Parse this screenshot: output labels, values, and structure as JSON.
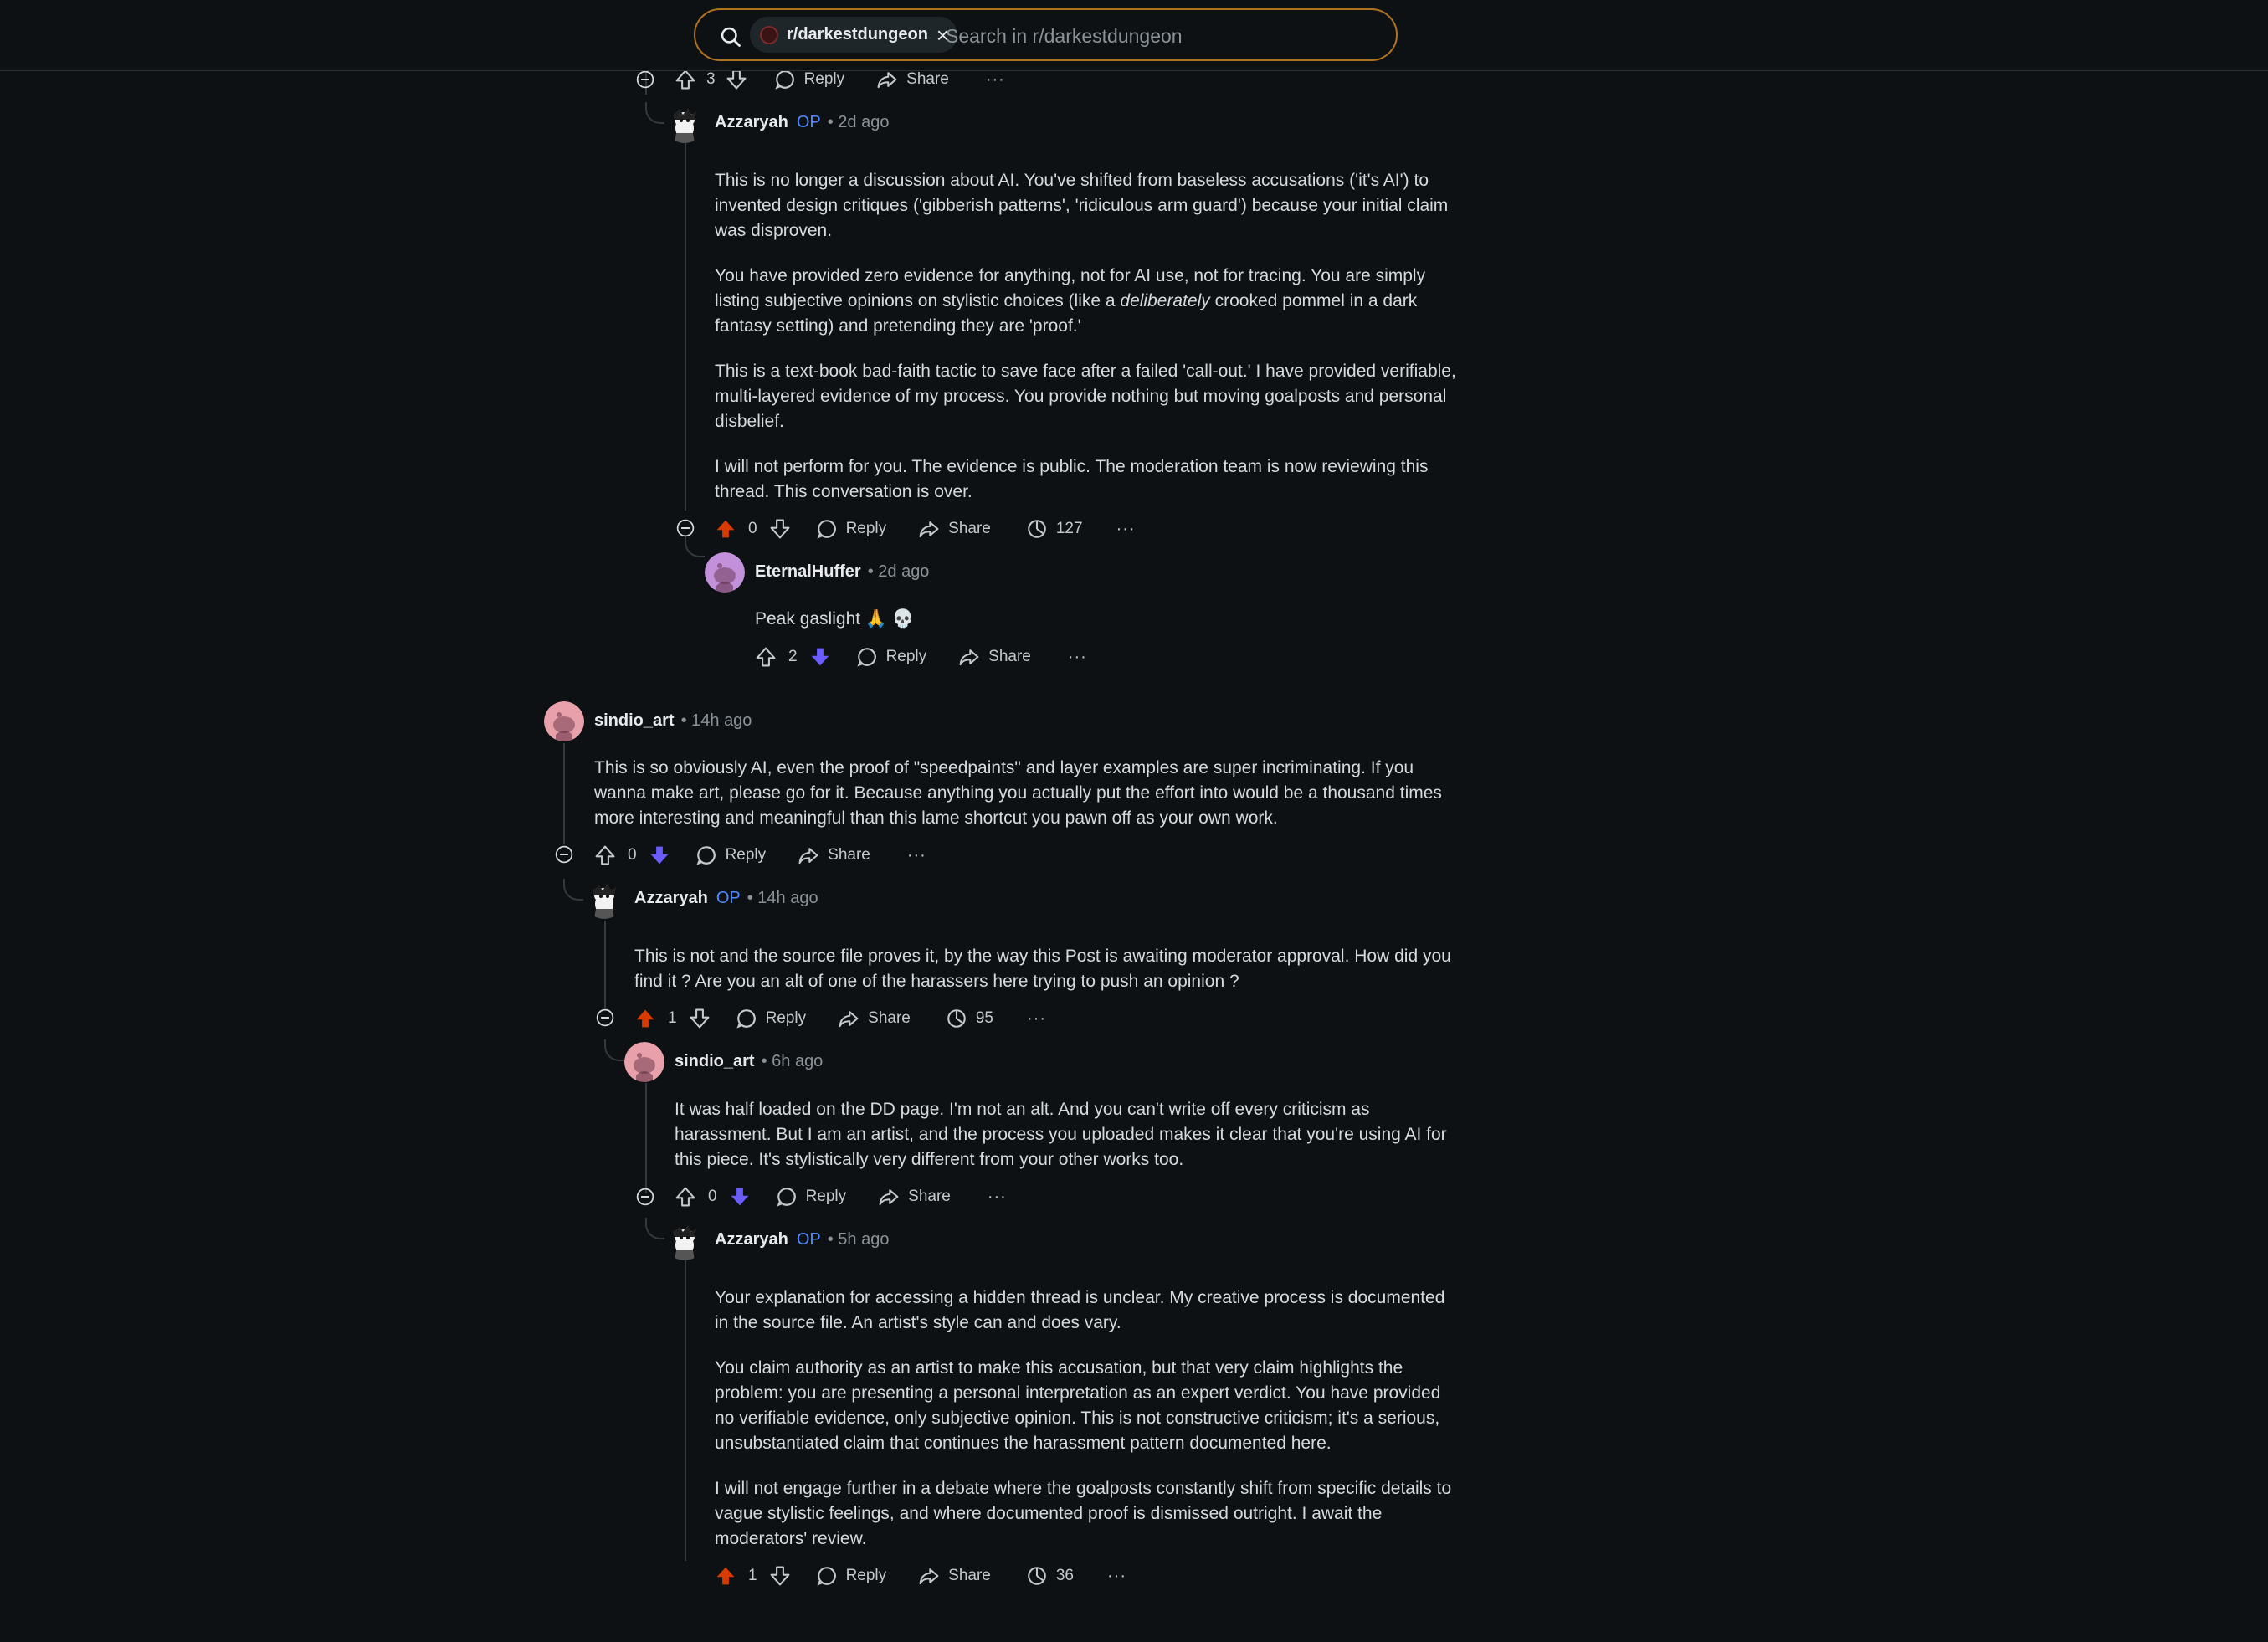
{
  "search": {
    "subreddit_chip": "r/darkestdungeon",
    "placeholder": "Search in r/darkestdungeon"
  },
  "actions_labels": {
    "reply": "Reply",
    "share": "Share"
  },
  "comments": {
    "top_actions": {
      "score": "3"
    },
    "c1": {
      "author": "Azzaryah",
      "op_label": "OP",
      "time": "• 2d ago",
      "p1": "This is no longer a discussion about AI. You've shifted from baseless accusations ('it's AI') to invented design critiques ('gibberish patterns', 'ridiculous arm guard') because your initial claim was disproven.",
      "p2a": "You have provided zero evidence for anything, not for AI use, not for tracing. You are simply listing subjective opinions on stylistic choices (like a ",
      "p2em": "deliberately",
      "p2b": " crooked pommel in a dark fantasy setting) and pretending they are 'proof.'",
      "p3": "This is a text-book bad-faith tactic to save face after a failed 'call-out.' I have provided verifiable, multi-layered evidence of my process. You provide nothing but moving goalposts and personal disbelief.",
      "p4": "I will not perform for you. The evidence is public. The moderation team is now reviewing this thread. This conversation is over.",
      "score": "0",
      "views": "127"
    },
    "c2": {
      "author": "EternalHuffer",
      "time": "• 2d ago",
      "text": "Peak gaslight 🙏 💀",
      "score": "2"
    },
    "c3": {
      "author": "sindio_art",
      "time": "• 14h ago",
      "text": "This is so obviously AI, even the proof of \"speedpaints\" and layer examples are super incriminating. If you wanna make art, please go for it. Because anything you actually put the effort into would be a thousand times more interesting and meaningful than this lame shortcut you pawn off as your own work.",
      "score": "0"
    },
    "c4": {
      "author": "Azzaryah",
      "op_label": "OP",
      "time": "• 14h ago",
      "text": "This is not and the source file proves it, by the way this Post is awaiting moderator approval. How did you find it ? Are you an alt of one of the harassers here trying to push an opinion ?",
      "score": "1",
      "views": "95"
    },
    "c5": {
      "author": "sindio_art",
      "time": "• 6h ago",
      "text": "It was half loaded on the DD page. I'm not an alt. And you can't write off every criticism as harassment. But I am an artist, and the process you uploaded makes it clear that you're using AI for this piece. It's stylistically very different from your other works too.",
      "score": "0"
    },
    "c6": {
      "author": "Azzaryah",
      "op_label": "OP",
      "time": "• 5h ago",
      "p1": "Your explanation for accessing a hidden thread is unclear. My creative process is documented in the source file. An artist's style can and does vary.",
      "p2": "You claim authority as an artist to make this accusation, but that very claim highlights the problem: you are presenting a personal interpretation as an expert verdict. You have provided no verifiable evidence, only subjective opinion. This is not constructive criticism; it's a serious, unsubstantiated claim that continues the harassment pattern documented here.",
      "p3": "I will not engage further in a debate where the goalposts constantly shift from specific details to vague stylistic feelings, and where documented proof is dismissed outright. I await the moderators' review.",
      "score": "1",
      "views": "36"
    }
  },
  "colors": {
    "upvote_active": "#d93a00",
    "downvote_active": "#6a5cff",
    "op": "#4a8cff",
    "search_border": "#b0721f"
  }
}
